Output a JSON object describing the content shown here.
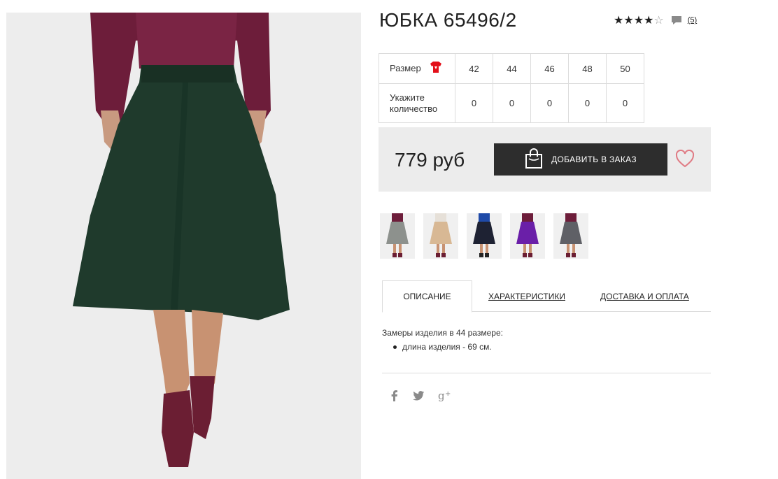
{
  "product": {
    "title": "ЮБКА 65496/2",
    "rating_value": 4,
    "rating_max": 5,
    "stars_filled": "★★★★",
    "stars_empty": "☆",
    "review_count": "(5)"
  },
  "sizes": {
    "size_label": "Размер",
    "quantity_label": "Укажите количество",
    "values": [
      "42",
      "44",
      "46",
      "48",
      "50"
    ],
    "quantities": [
      "0",
      "0",
      "0",
      "0",
      "0"
    ]
  },
  "buy": {
    "price": "779 руб",
    "add_button_label": "ДОБАВИТЬ В ЗАКАЗ"
  },
  "thumbnails": [
    {
      "color_name": "grey",
      "skirt_color": "#8d918d"
    },
    {
      "color_name": "beige",
      "skirt_color": "#d8b894"
    },
    {
      "color_name": "navy",
      "skirt_color": "#1e2233"
    },
    {
      "color_name": "purple",
      "skirt_color": "#6a1fa8"
    },
    {
      "color_name": "grey-dark",
      "skirt_color": "#5f6066"
    }
  ],
  "tabs": {
    "description": "ОПИСАНИЕ",
    "characteristics": "ХАРАКТЕРИСТИКИ",
    "delivery": "ДОСТАВКА И ОПЛАТА"
  },
  "description": {
    "intro": "Замеры изделия в 44 размере:",
    "items": [
      "длина изделия - 69 см."
    ]
  },
  "social": {
    "facebook": "f",
    "twitter": "t",
    "google_plus": "g+"
  },
  "colors": {
    "accent_heart": "#e07b84",
    "button_bg": "#2d2d2d",
    "size_icon": "#e3101a",
    "main_skirt": "#1f3a2c",
    "sweater": "#6d1d3a"
  }
}
